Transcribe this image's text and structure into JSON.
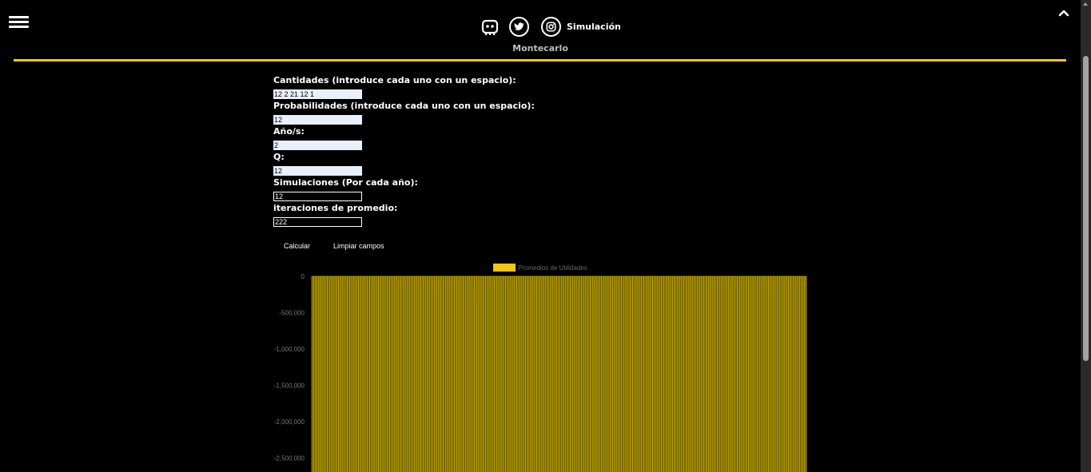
{
  "header": {
    "nav_title": "Simulación",
    "sub_title": "Montecarlo"
  },
  "form": {
    "fields": [
      {
        "label": "Cantidades (introduce cada uno con un espacio):",
        "value": "12 2 21 12 1"
      },
      {
        "label": "Probabilidades (introduce cada uno con un espacio):",
        "value": "12"
      },
      {
        "label": "Año/s:",
        "value": "2"
      },
      {
        "label": "Q:",
        "value": "12"
      },
      {
        "label": "Simulaciones (Por cada año):",
        "value": "12"
      },
      {
        "label": "iteraciones de promedio:",
        "value": "222"
      }
    ],
    "calc_label": "Calcular",
    "clear_label": "Limpiar campos"
  },
  "colors": {
    "accent": "#f5c518",
    "bar_fill": "#7a6a00",
    "bar_stroke": "#d4b800"
  },
  "icons": [
    "menu-icon",
    "discord-icon",
    "twitter-icon",
    "instagram-icon",
    "chevron-up-icon"
  ],
  "chart_data": {
    "type": "bar",
    "legend": [
      "Promedios de Utilidades"
    ],
    "legend_position": "top",
    "y_ticks": [
      "0",
      "-500,000",
      "-1,000,000",
      "-1,500,000",
      "-2,000,000",
      "-2,500,000"
    ],
    "ylim": [
      -2700000,
      0
    ],
    "bar_count": 222,
    "values_note_visible": "all bars extend below the visible area",
    "series": [
      {
        "name": "Promedios de Utilidades",
        "values_below_min": true
      }
    ]
  }
}
